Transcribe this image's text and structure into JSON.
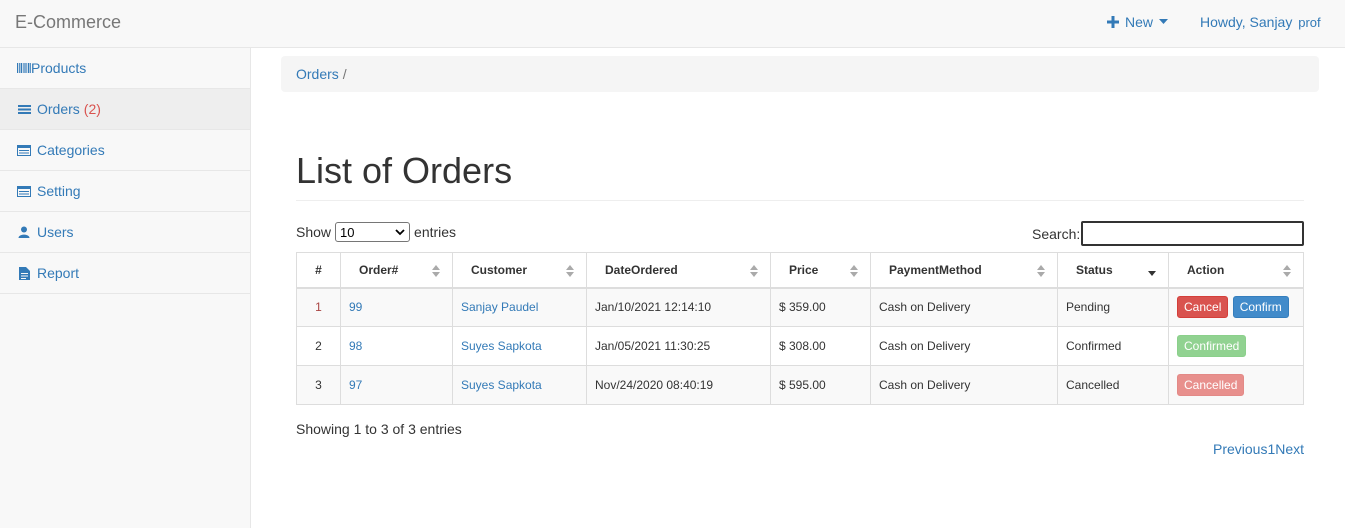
{
  "navbar": {
    "brand": "E-Commerce",
    "new_label": "New",
    "user_greeting": "Howdy, Sanjay",
    "user_extra": "prof"
  },
  "sidebar": {
    "items": [
      {
        "label": "Products",
        "icon": "barcode-icon"
      },
      {
        "label": "Orders",
        "count": "(2)",
        "icon": "list-icon"
      },
      {
        "label": "Categories",
        "icon": "table-icon"
      },
      {
        "label": "Setting",
        "icon": "table-icon"
      },
      {
        "label": "Users",
        "icon": "user-icon"
      },
      {
        "label": "Report",
        "icon": "file-icon"
      }
    ]
  },
  "breadcrumb": {
    "link": "Orders",
    "sep": "/"
  },
  "page": {
    "title": "List of Orders"
  },
  "controls": {
    "show_label": "Show",
    "entries_value": "10",
    "entries_label": "entries",
    "search_label": "Search:"
  },
  "table": {
    "headers": [
      "#",
      "Order#",
      "Customer",
      "DateOrdered",
      "Price",
      "PaymentMethod",
      "Status",
      "Action"
    ],
    "rows": [
      {
        "n": "1",
        "order": "99",
        "customer": "Sanjay Paudel",
        "date": "Jan/10/2021 12:14:10",
        "price": "$ 359.00",
        "method": "Cash on Delivery",
        "status": "Pending",
        "actions": [
          "Cancel",
          "Confirm"
        ]
      },
      {
        "n": "2",
        "order": "98",
        "customer": "Suyes Sapkota",
        "date": "Jan/05/2021 11:30:25",
        "price": "$ 308.00",
        "method": "Cash on Delivery",
        "status": "Confirmed",
        "actions": [
          "Confirmed"
        ]
      },
      {
        "n": "3",
        "order": "97",
        "customer": "Suyes Sapkota",
        "date": "Nov/24/2020 08:40:19",
        "price": "$ 595.00",
        "method": "Cash on Delivery",
        "status": "Cancelled",
        "actions": [
          "Cancelled"
        ]
      }
    ]
  },
  "footer": {
    "showing": "Showing 1 to 3 of 3 entries",
    "previous": "Previous",
    "page": "1",
    "next": "Next"
  },
  "colors": {
    "link": "#337ab7",
    "danger": "#d9534f",
    "primary": "#428bca"
  }
}
